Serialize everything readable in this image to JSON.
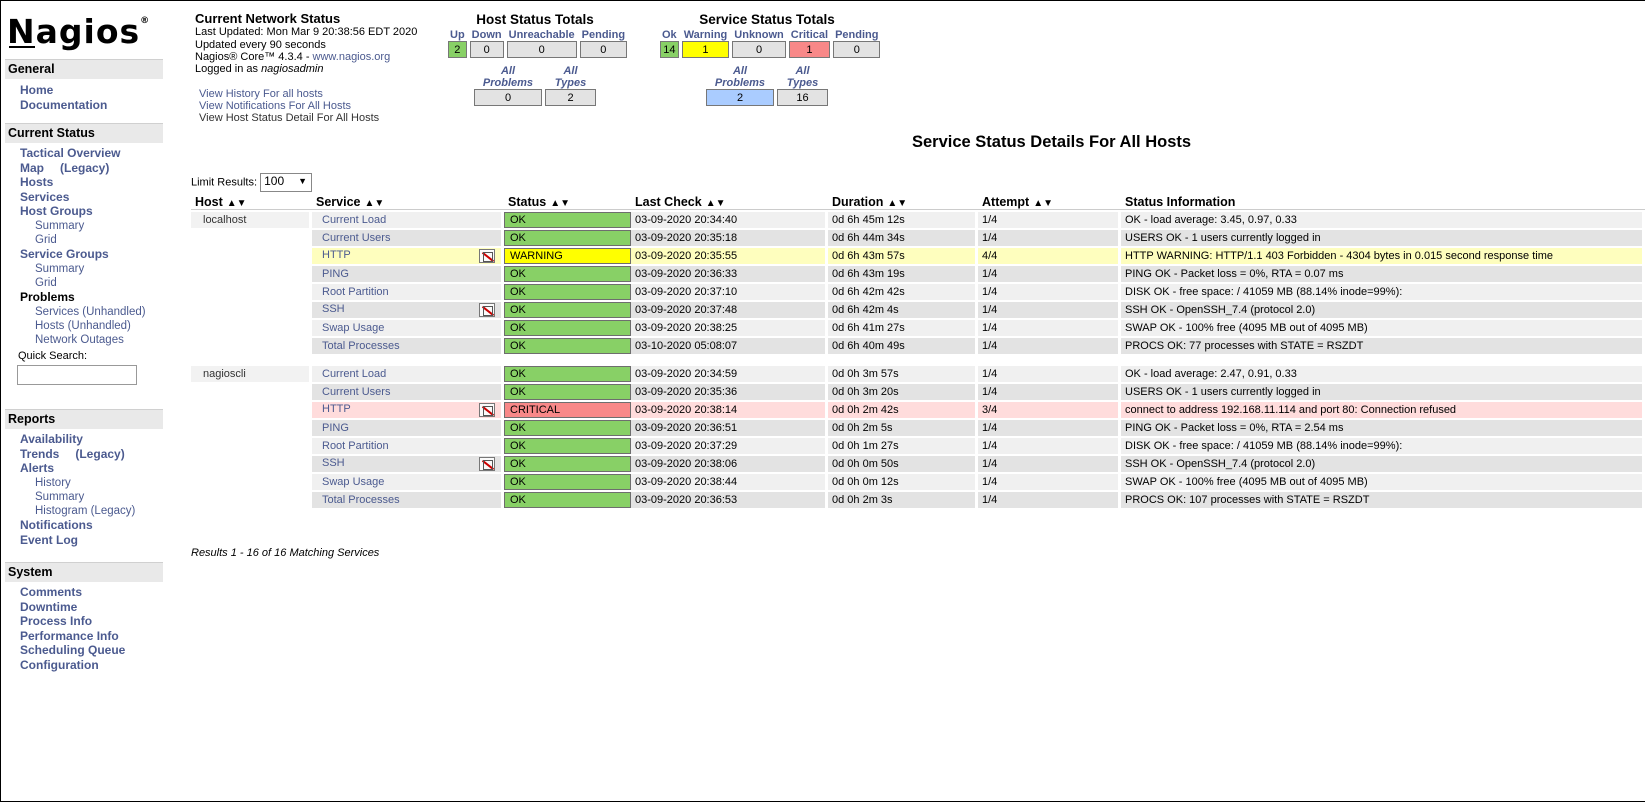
{
  "sidebar": {
    "logo": "Nagios",
    "logo_mark": "®",
    "general": {
      "title": "General",
      "home": "Home",
      "documentation": "Documentation"
    },
    "current_status": {
      "title": "Current Status",
      "tactical_overview": "Tactical Overview",
      "map": "Map",
      "map_legacy": "(Legacy)",
      "hosts": "Hosts",
      "services": "Services",
      "host_groups": "Host Groups",
      "host_groups_summary": "Summary",
      "host_groups_grid": "Grid",
      "service_groups": "Service Groups",
      "service_groups_summary": "Summary",
      "service_groups_grid": "Grid",
      "problems": "Problems",
      "services_unhandled": "Services (Unhandled)",
      "hosts_unhandled": "Hosts (Unhandled)",
      "network_outages": "Network Outages",
      "quick_search_label": "Quick Search:"
    },
    "reports": {
      "title": "Reports",
      "availability": "Availability",
      "trends": "Trends",
      "trends_legacy": "(Legacy)",
      "alerts": "Alerts",
      "alerts_history": "History",
      "alerts_summary": "Summary",
      "alerts_histogram": "Histogram (Legacy)",
      "notifications": "Notifications",
      "event_log": "Event Log"
    },
    "system": {
      "title": "System",
      "comments": "Comments",
      "downtime": "Downtime",
      "process_info": "Process Info",
      "performance_info": "Performance Info",
      "scheduling_queue": "Scheduling Queue",
      "configuration": "Configuration"
    }
  },
  "network_status": {
    "title": "Current Network Status",
    "last_updated": "Last Updated: Mon Mar 9 20:38:56 EDT 2020",
    "update_interval": "Updated every 90 seconds",
    "version_prefix": "Nagios® Core™ 4.3.4 - ",
    "version_link": "www.nagios.org",
    "logged_in_prefix": "Logged in as ",
    "logged_in_user": "nagiosadmin",
    "links": [
      "View History For all hosts",
      "View Notifications For All Hosts",
      "View Host Status Detail For All Hosts"
    ]
  },
  "host_totals": {
    "title": "Host Status Totals",
    "labels": {
      "up": "Up",
      "down": "Down",
      "unreachable": "Unreachable",
      "pending": "Pending"
    },
    "values": {
      "up": "2",
      "down": "0",
      "unreachable": "0",
      "pending": "0"
    },
    "problems_label": "All Problems",
    "types_label": "All Types",
    "problems_value": "0",
    "types_value": "2"
  },
  "service_totals": {
    "title": "Service Status Totals",
    "labels": {
      "ok": "Ok",
      "warning": "Warning",
      "unknown": "Unknown",
      "critical": "Critical",
      "pending": "Pending"
    },
    "values": {
      "ok": "14",
      "warning": "1",
      "unknown": "0",
      "critical": "1",
      "pending": "0"
    },
    "problems_label": "All Problems",
    "types_label": "All Types",
    "problems_value": "2",
    "types_value": "16"
  },
  "main": {
    "title": "Service Status Details For All Hosts",
    "limit_label": "Limit Results:",
    "limit_value": "100",
    "columns": [
      "Host",
      "Service",
      "Status",
      "Last Check",
      "Duration",
      "Attempt",
      "Status Information"
    ],
    "results": "Results 1 - 16 of 16 Matching Services"
  },
  "rows": [
    {
      "host": "localhost",
      "service": "Current Load",
      "status": "OK",
      "last_check": "03-09-2020 20:34:40",
      "duration": "0d 6h 45m 12s",
      "attempt": "1/4",
      "info": "OK - load average: 3.45, 0.97, 0.33"
    },
    {
      "host": "",
      "service": "Current Users",
      "status": "OK",
      "last_check": "03-09-2020 20:35:18",
      "duration": "0d 6h 44m 34s",
      "attempt": "1/4",
      "info": "USERS OK - 1 users currently logged in"
    },
    {
      "host": "",
      "service": "HTTP",
      "status": "WARNING",
      "last_check": "03-09-2020 20:35:55",
      "duration": "0d 6h 43m 57s",
      "attempt": "4/4",
      "info": "HTTP WARNING: HTTP/1.1 403 Forbidden - 4304 bytes in 0.015 second response time"
    },
    {
      "host": "",
      "service": "PING",
      "status": "OK",
      "last_check": "03-09-2020 20:36:33",
      "duration": "0d 6h 43m 19s",
      "attempt": "1/4",
      "info": "PING OK - Packet loss = 0%, RTA = 0.07 ms"
    },
    {
      "host": "",
      "service": "Root Partition",
      "status": "OK",
      "last_check": "03-09-2020 20:37:10",
      "duration": "0d 6h 42m 42s",
      "attempt": "1/4",
      "info": "DISK OK - free space: / 41059 MB (88.14% inode=99%):"
    },
    {
      "host": "",
      "service": "SSH",
      "status": "OK",
      "last_check": "03-09-2020 20:37:48",
      "duration": "0d 6h 42m 4s",
      "attempt": "1/4",
      "info": "SSH OK - OpenSSH_7.4 (protocol 2.0)"
    },
    {
      "host": "",
      "service": "Swap Usage",
      "status": "OK",
      "last_check": "03-09-2020 20:38:25",
      "duration": "0d 6h 41m 27s",
      "attempt": "1/4",
      "info": "SWAP OK - 100% free (4095 MB out of 4095 MB)"
    },
    {
      "host": "",
      "service": "Total Processes",
      "status": "OK",
      "last_check": "03-10-2020 05:08:07",
      "duration": "0d 6h 40m 49s",
      "attempt": "1/4",
      "info": "PROCS OK: 77 processes with STATE = RSZDT"
    },
    {
      "host": "nagioscli",
      "service": "Current Load",
      "status": "OK",
      "last_check": "03-09-2020 20:34:59",
      "duration": "0d 0h 3m 57s",
      "attempt": "1/4",
      "info": "OK - load average: 2.47, 0.91, 0.33"
    },
    {
      "host": "",
      "service": "Current Users",
      "status": "OK",
      "last_check": "03-09-2020 20:35:36",
      "duration": "0d 0h 3m 20s",
      "attempt": "1/4",
      "info": "USERS OK - 1 users currently logged in"
    },
    {
      "host": "",
      "service": "HTTP",
      "status": "CRITICAL",
      "last_check": "03-09-2020 20:38:14",
      "duration": "0d 0h 2m 42s",
      "attempt": "3/4",
      "info": "connect to address 192.168.11.114 and port 80: Connection refused"
    },
    {
      "host": "",
      "service": "PING",
      "status": "OK",
      "last_check": "03-09-2020 20:36:51",
      "duration": "0d 0h 2m 5s",
      "attempt": "1/4",
      "info": "PING OK - Packet loss = 0%, RTA = 2.54 ms"
    },
    {
      "host": "",
      "service": "Root Partition",
      "status": "OK",
      "last_check": "03-09-2020 20:37:29",
      "duration": "0d 0h 1m 27s",
      "attempt": "1/4",
      "info": "DISK OK - free space: / 41059 MB (88.14% inode=99%):"
    },
    {
      "host": "",
      "service": "SSH",
      "status": "OK",
      "last_check": "03-09-2020 20:38:06",
      "duration": "0d 0h 0m 50s",
      "attempt": "1/4",
      "info": "SSH OK - OpenSSH_7.4 (protocol 2.0)"
    },
    {
      "host": "",
      "service": "Swap Usage",
      "status": "OK",
      "last_check": "03-09-2020 20:38:44",
      "duration": "0d 0h 0m 12s",
      "attempt": "1/4",
      "info": "SWAP OK - 100% free (4095 MB out of 4095 MB)"
    },
    {
      "host": "",
      "service": "Total Processes",
      "status": "OK",
      "last_check": "03-09-2020 20:36:53",
      "duration": "0d 0h 2m 3s",
      "attempt": "1/4",
      "info": "PROCS OK: 107 processes with STATE = RSZDT"
    }
  ],
  "colors": {
    "ok": "#88d066",
    "warning": "#ffff00",
    "critical": "#f88888",
    "link": "#4b5a8f",
    "problems_highlight": "#aaccff"
  }
}
